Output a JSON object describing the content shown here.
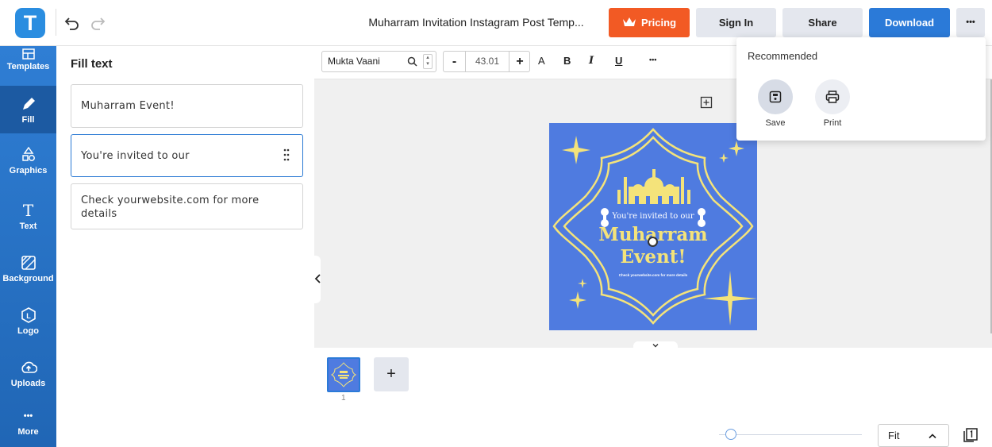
{
  "header": {
    "logo_letter": "T",
    "doc_title": "Muharram Invitation Instagram Post Temp...",
    "pricing": "Pricing",
    "signin": "Sign In",
    "share": "Share",
    "download": "Download",
    "more": "•••"
  },
  "sidebar": {
    "items": [
      {
        "label": "Templates",
        "icon": "templates-icon"
      },
      {
        "label": "Fill",
        "icon": "pencil-icon"
      },
      {
        "label": "Graphics",
        "icon": "shapes-icon"
      },
      {
        "label": "Text",
        "icon": "text-icon"
      },
      {
        "label": "Background",
        "icon": "background-icon"
      },
      {
        "label": "Logo",
        "icon": "logo-icon"
      },
      {
        "label": "Uploads",
        "icon": "upload-icon"
      },
      {
        "label": "More",
        "icon": "more-icon"
      }
    ]
  },
  "panel": {
    "title": "Fill text",
    "fields": [
      "Muharram Event!",
      "You're invited to our",
      "Check yourwebsite.com for more details"
    ]
  },
  "toolbar": {
    "font": "Mukta Vaani",
    "minus": "-",
    "size": "43.01",
    "plus": "+",
    "a": "A",
    "bold": "B",
    "italic": "I",
    "underline": "U",
    "more": "•••"
  },
  "dropdown": {
    "title": "Recommended",
    "save": "Save",
    "print": "Print"
  },
  "canvas": {
    "invited": "You're invited to our",
    "muharram": "Muharram",
    "event": "Event!",
    "details": "Check yourwebsite.com for more details",
    "bg": "#4f7be0",
    "accent": "#f4e37a"
  },
  "pages": {
    "number": "1",
    "add": "+"
  },
  "zoom": {
    "label": "Fit"
  }
}
